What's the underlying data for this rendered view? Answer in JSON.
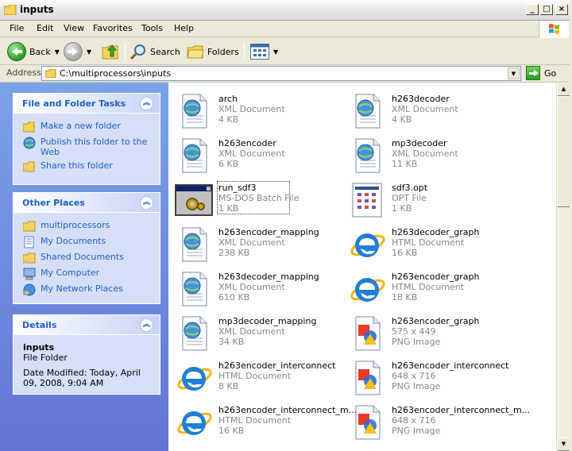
{
  "window": {
    "title": "inputs"
  },
  "menu": {
    "items": [
      "File",
      "Edit",
      "View",
      "Favorites",
      "Tools",
      "Help"
    ]
  },
  "toolbar": {
    "back_label": "Back",
    "search_label": "Search",
    "folders_label": "Folders"
  },
  "address": {
    "label": "Address",
    "value": "C:\\multiprocessors\\inputs",
    "go_label": "Go"
  },
  "tasks": {
    "title": "File and Folder Tasks",
    "items": [
      "Make a new folder",
      "Publish this folder to the Web",
      "Share this folder"
    ]
  },
  "places": {
    "title": "Other Places",
    "items": [
      "multiprocessors",
      "My Documents",
      "Shared Documents",
      "My Computer",
      "My Network Places"
    ]
  },
  "details": {
    "title": "Details",
    "name": "inputs",
    "type": "File Folder",
    "modified": "Date Modified: Today, April 09, 2008, 9:04 AM"
  },
  "files": [
    {
      "name": "arch",
      "type": "XML Document",
      "size": "4 KB",
      "icon": "xml-icon"
    },
    {
      "name": "h263decoder",
      "type": "XML Document",
      "size": "4 KB",
      "icon": "xml-icon"
    },
    {
      "name": "h263encoder",
      "type": "XML Document",
      "size": "6 KB",
      "icon": "xml-icon"
    },
    {
      "name": "mp3decoder",
      "type": "XML Document",
      "size": "11 KB",
      "icon": "xml-icon"
    },
    {
      "name": "run_sdf3",
      "type": "MS-DOS Batch File",
      "size": "1 KB",
      "icon": "batch-icon"
    },
    {
      "name": "sdf3.opt",
      "type": "OPT File",
      "size": "1 KB",
      "icon": "opt-icon"
    },
    {
      "name": "h263encoder_mapping",
      "type": "XML Document",
      "size": "238 KB",
      "icon": "xml-icon"
    },
    {
      "name": "h263decoder_graph",
      "type": "HTML Document",
      "size": "16 KB",
      "icon": "ie-icon"
    },
    {
      "name": "h263decoder_mapping",
      "type": "XML Document",
      "size": "610 KB",
      "icon": "xml-icon"
    },
    {
      "name": "h263encoder_graph",
      "type": "HTML Document",
      "size": "18 KB",
      "icon": "ie-icon"
    },
    {
      "name": "mp3decoder_mapping",
      "type": "XML Document",
      "size": "34 KB",
      "icon": "xml-icon"
    },
    {
      "name": "h263encoder_graph",
      "type": "575 x 449",
      "size": "PNG Image",
      "icon": "png-icon"
    },
    {
      "name": "h263encoder_interconnect",
      "type": "HTML Document",
      "size": "8 KB",
      "icon": "ie-icon"
    },
    {
      "name": "h263encoder_interconnect",
      "type": "648 x 716",
      "size": "PNG Image",
      "icon": "png-icon"
    },
    {
      "name": "h263encoder_interconnect_m...",
      "type": "HTML Document",
      "size": "16 KB",
      "icon": "ie-icon"
    },
    {
      "name": "h263encoder_interconnect_m...",
      "type": "648 x 716",
      "size": "PNG Image",
      "icon": "png-icon"
    }
  ]
}
